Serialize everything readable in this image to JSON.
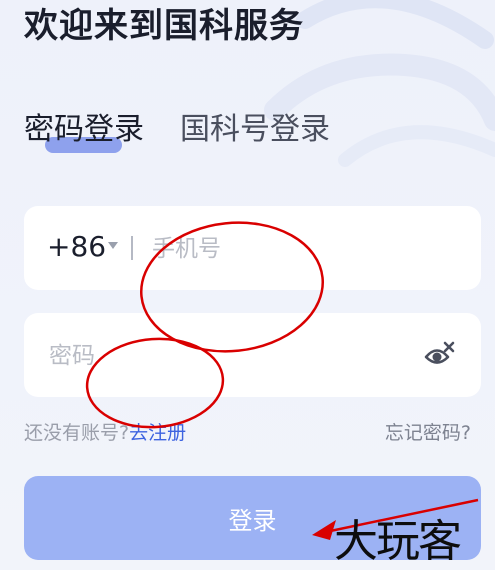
{
  "header": {
    "welcome_title": "欢迎来到国科服务"
  },
  "tabs": [
    {
      "label": "密码登录",
      "active": true
    },
    {
      "label": "国科号登录",
      "active": false
    }
  ],
  "phone_field": {
    "country_code": "+86",
    "placeholder": "手机号",
    "value": ""
  },
  "password_field": {
    "placeholder": "密码",
    "value": "",
    "visibility_icon": "eye-hidden-icon"
  },
  "register": {
    "prompt": "还没有账号?",
    "link_label": "去注册"
  },
  "forgot_label": "忘记密码?",
  "login_button_label": "登录",
  "watermark_text": "大玩客",
  "colors": {
    "accent": "#3d63e0",
    "button": "#9cb2f4",
    "tab_underline": "#7c93ea",
    "annotation_red": "#d90000"
  }
}
